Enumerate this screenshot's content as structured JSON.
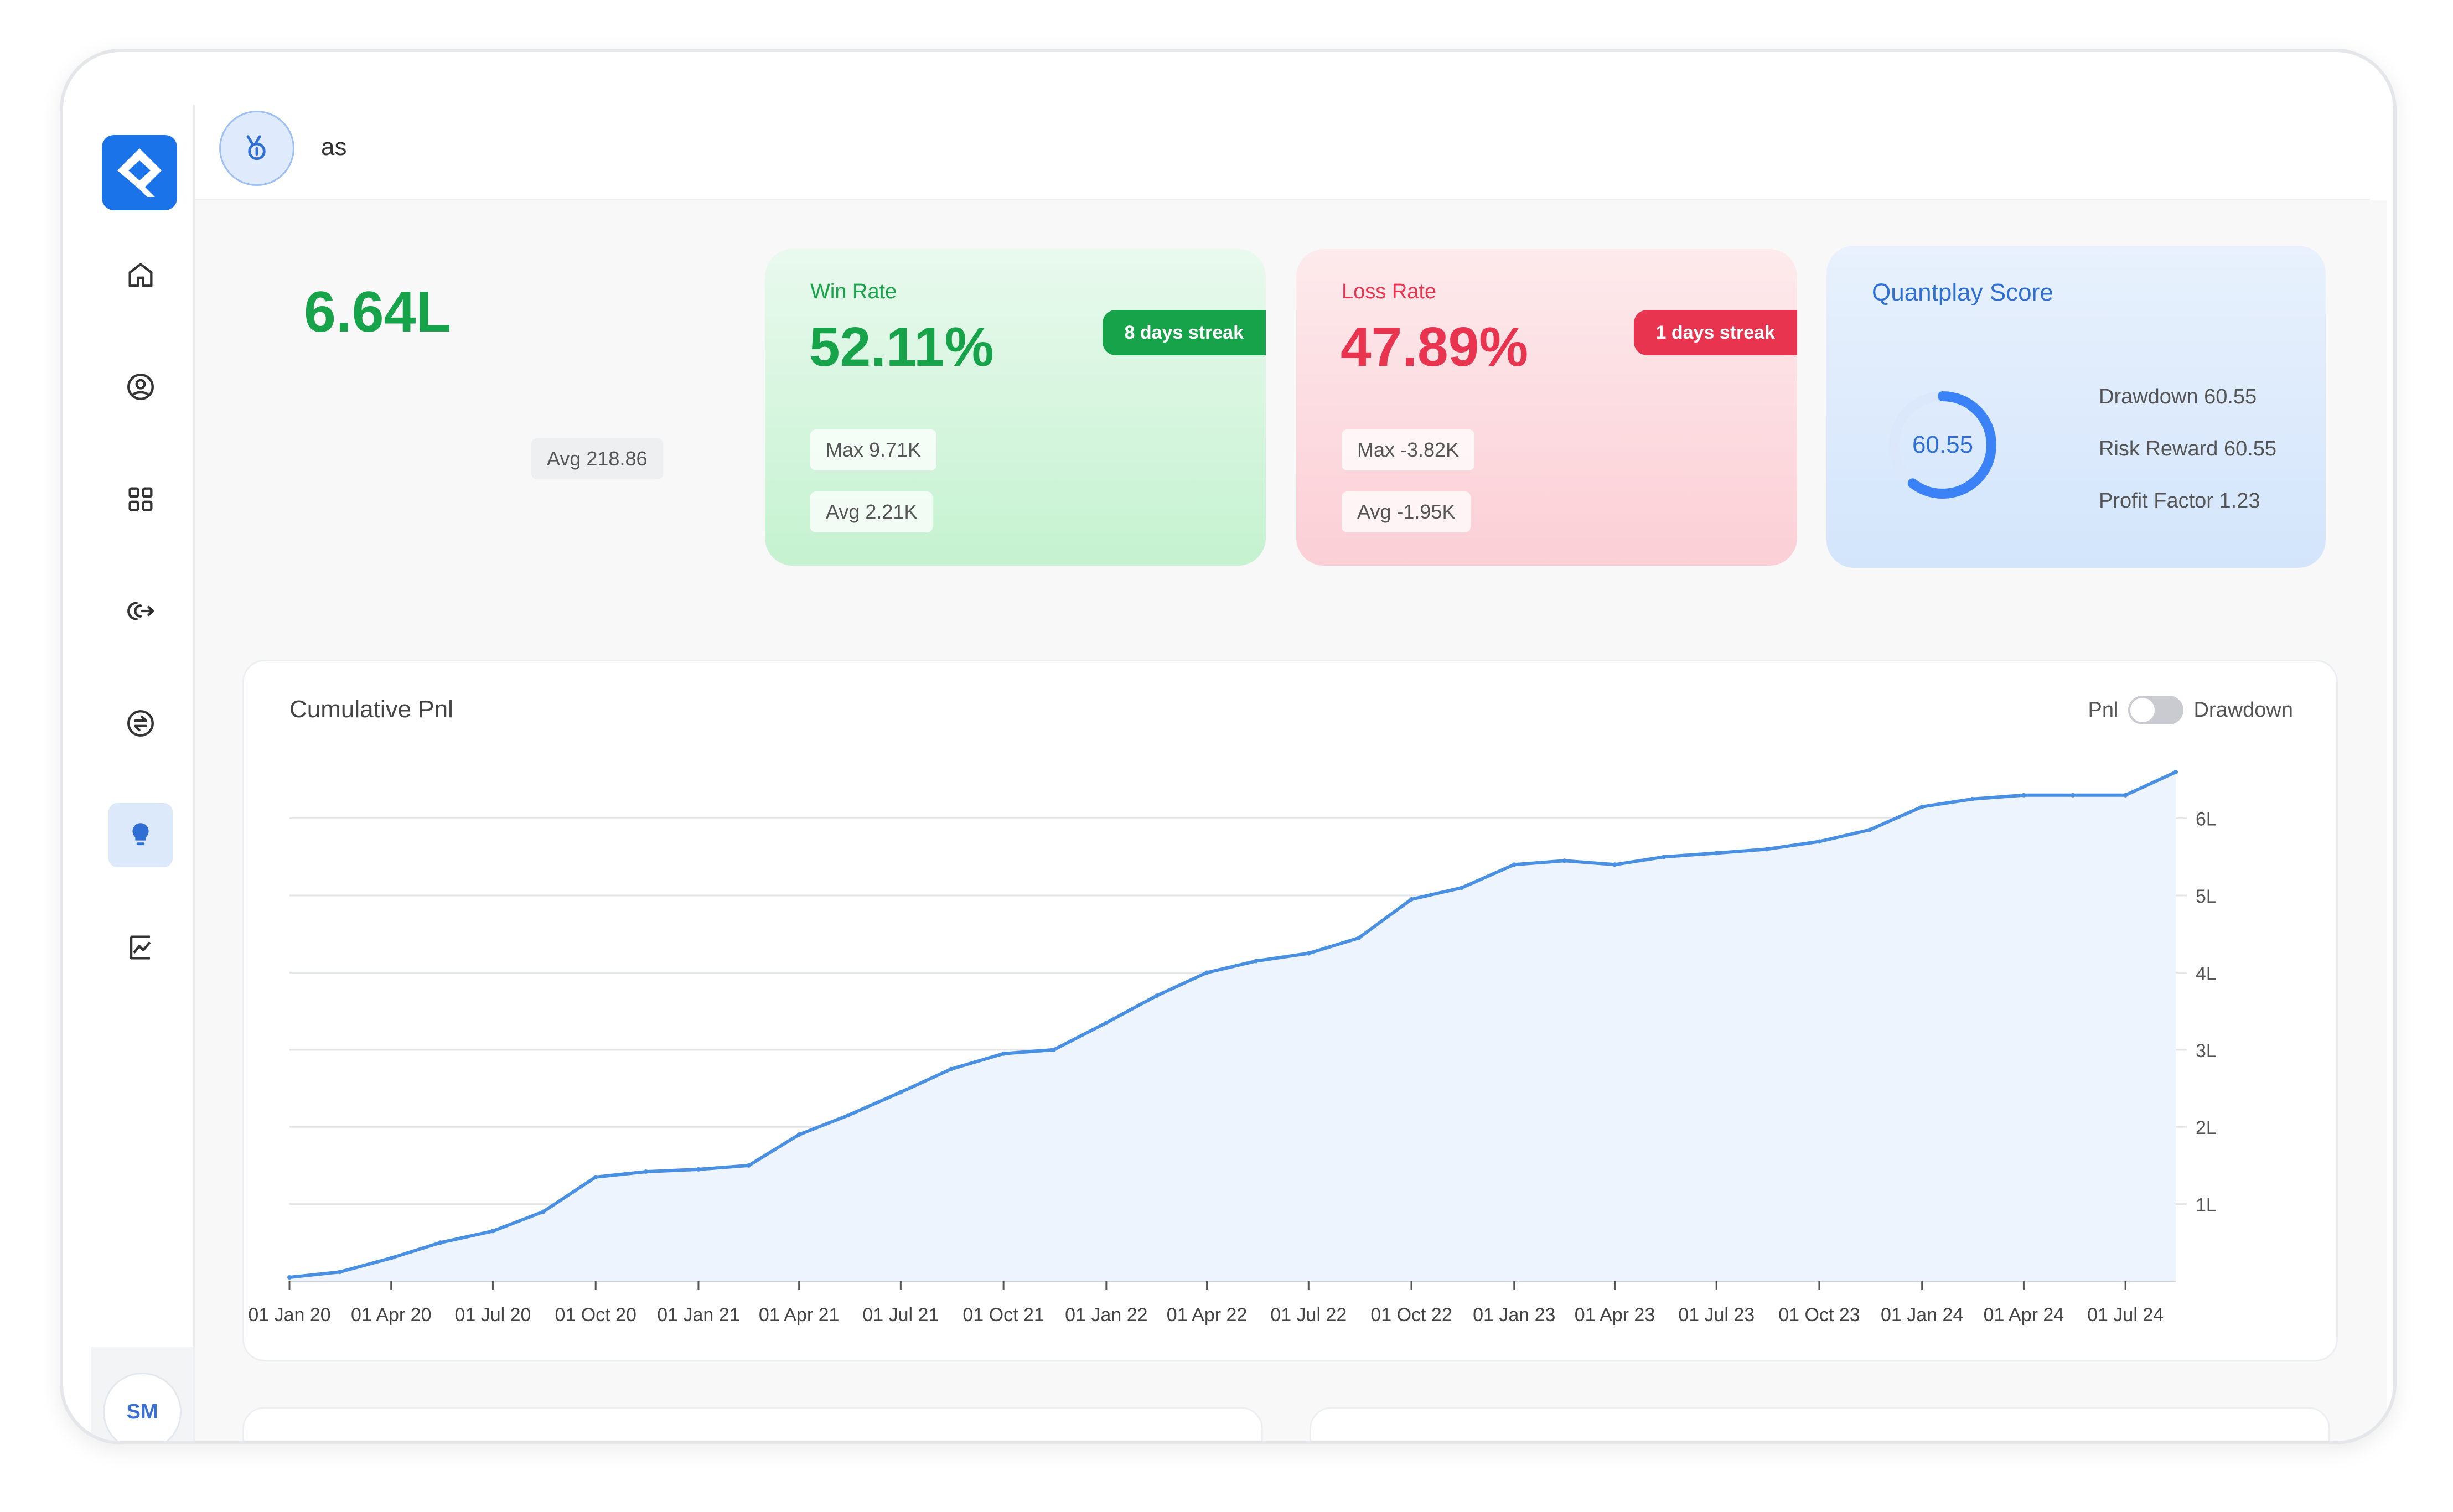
{
  "header": {
    "account_name": "as"
  },
  "user": {
    "initials": "SM"
  },
  "summary": {
    "total_pnl": "6.64L",
    "avg": "Avg 218.86"
  },
  "win": {
    "label": "Win Rate",
    "rate": "52.11%",
    "streak": "8 days streak",
    "max": "Max 9.71K",
    "avg": "Avg 2.21K",
    "color": "#17a34a"
  },
  "loss": {
    "label": "Loss Rate",
    "rate": "47.89%",
    "streak": "1 days streak",
    "max": "Max -3.82K",
    "avg": "Avg -1.95K",
    "color": "#e8344e"
  },
  "score": {
    "title": "Quantplay Score",
    "value": "60.55",
    "fill": 0.6055,
    "metrics": [
      "Drawdown 60.55",
      "Risk Reward 60.55",
      "Profit Factor 1.23"
    ]
  },
  "chart": {
    "title": "Cumulative Pnl",
    "toggle_left": "Pnl",
    "toggle_right": "Drawdown"
  },
  "chart_data": {
    "type": "area",
    "title": "Cumulative Pnl",
    "x_tick_labels": [
      "01 Jan 20",
      "01 Apr 20",
      "01 Jul 20",
      "01 Oct 20",
      "01 Jan 21",
      "01 Apr 21",
      "01 Jul 21",
      "01 Oct 21",
      "01 Jan 22",
      "01 Apr 22",
      "01 Jul 22",
      "01 Oct 22",
      "01 Jan 23",
      "01 Apr 23",
      "01 Jul 23",
      "01 Oct 23",
      "01 Jan 24",
      "01 Apr 24",
      "01 Jul 24"
    ],
    "y_tick_labels": [
      "1L",
      "2L",
      "3L",
      "4L",
      "5L",
      "6L"
    ],
    "y_ticks": [
      1,
      2,
      3,
      4,
      5,
      6
    ],
    "ylim": [
      0,
      6.6
    ],
    "grid": true,
    "line_color": "#4a90e2",
    "fill_color": "#eef4fd",
    "series": [
      {
        "x": [
          "2020-01-01",
          "2020-02-15",
          "2020-04-01",
          "2020-05-15",
          "2020-07-01",
          "2020-08-15",
          "2020-10-01",
          "2020-11-15",
          "2021-01-01",
          "2021-02-15",
          "2021-04-01",
          "2021-05-15",
          "2021-07-01",
          "2021-08-15",
          "2021-10-01",
          "2021-11-15",
          "2022-01-01",
          "2022-02-15",
          "2022-04-01",
          "2022-05-15",
          "2022-07-01",
          "2022-08-15",
          "2022-10-01",
          "2022-11-15",
          "2023-01-01",
          "2023-02-15",
          "2023-04-01",
          "2023-05-15",
          "2023-07-01",
          "2023-08-15",
          "2023-10-01",
          "2023-11-15",
          "2024-01-01",
          "2024-02-15",
          "2024-04-01",
          "2024-05-15",
          "2024-07-01",
          "2024-08-15"
        ],
        "values": [
          0.05,
          0.12,
          0.3,
          0.5,
          0.65,
          0.9,
          1.35,
          1.42,
          1.45,
          1.5,
          1.9,
          2.15,
          2.45,
          2.75,
          2.95,
          3.0,
          3.35,
          3.7,
          4.0,
          4.15,
          4.25,
          4.45,
          4.95,
          5.1,
          5.4,
          5.45,
          5.4,
          5.5,
          5.55,
          5.6,
          5.7,
          5.85,
          6.15,
          6.25,
          6.3,
          6.3,
          6.3,
          6.6
        ]
      }
    ]
  }
}
